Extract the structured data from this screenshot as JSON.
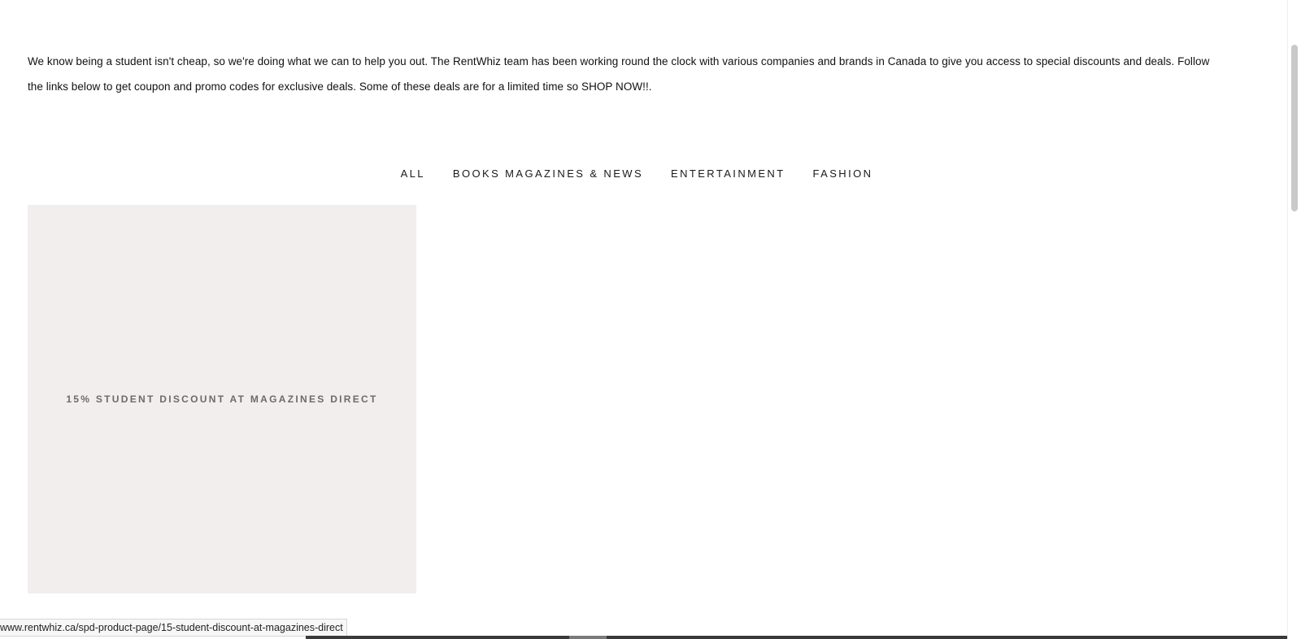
{
  "intro": {
    "text": "We know being a student isn't cheap, so we're doing what we can to help you out. The RentWhiz team has been working round the clock with various companies and brands in Canada to give you access to special discounts and deals. Follow the links below to get coupon and promo codes for exclusive deals. Some of these deals are for a limited time so SHOP NOW!!."
  },
  "categories": [
    {
      "label": "ALL"
    },
    {
      "label": "BOOKS MAGAZINES & NEWS"
    },
    {
      "label": "ENTERTAINMENT"
    },
    {
      "label": "FASHION"
    }
  ],
  "products": [
    {
      "title": "15% STUDENT DISCOUNT AT MAGAZINES DIRECT"
    }
  ],
  "status_bar": {
    "url": "www.rentwhiz.ca/spd-product-page/15-student-discount-at-magazines-direct"
  },
  "colors": {
    "card_background": "#f2eeed",
    "card_text": "#6b6b6b",
    "text": "#111111"
  }
}
